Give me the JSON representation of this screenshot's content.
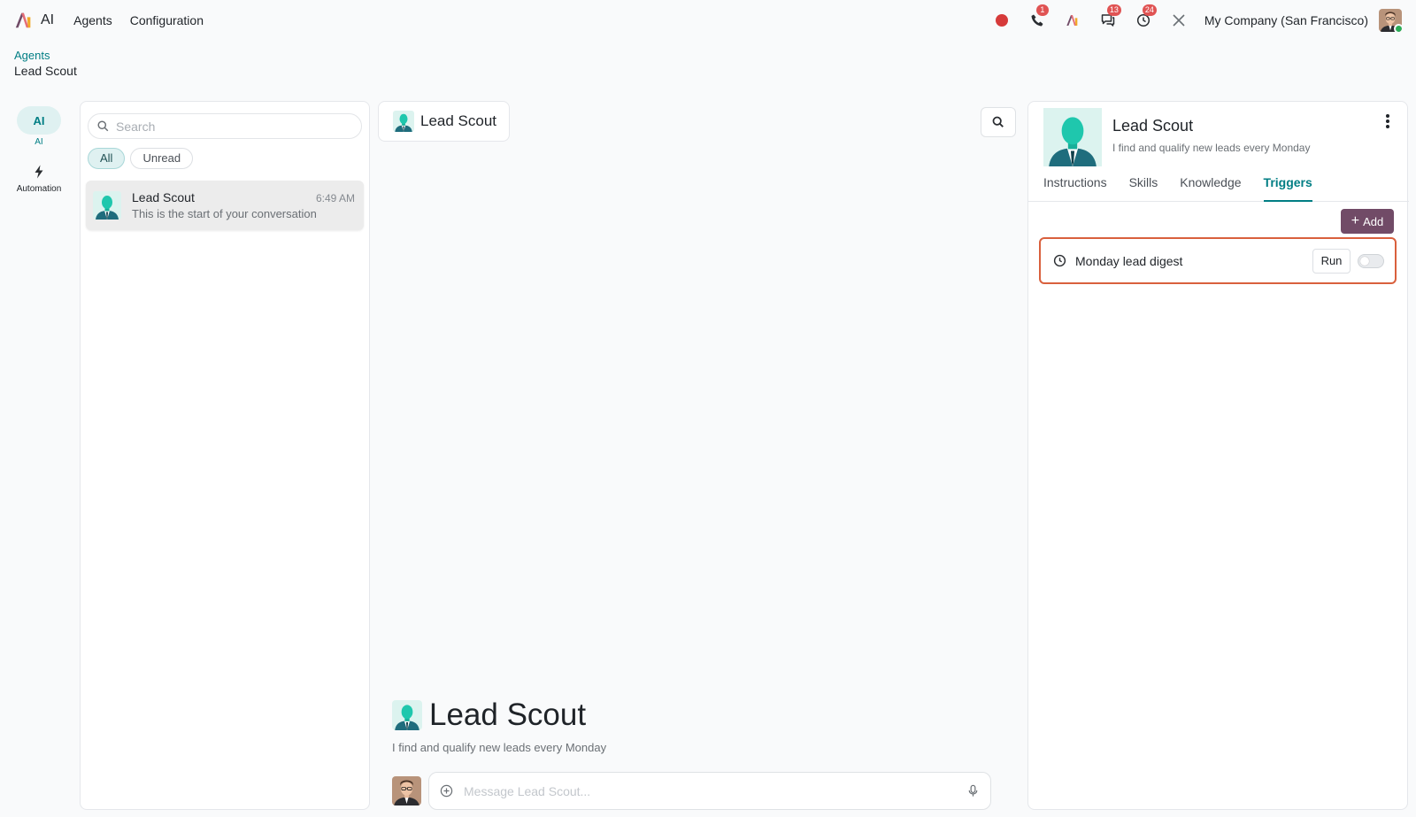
{
  "topbar": {
    "app_name": "AI",
    "nav": [
      "Agents",
      "Configuration"
    ],
    "badges": {
      "phone": "1",
      "messages": "13",
      "activities": "24"
    },
    "company": "My Company (San Francisco)"
  },
  "breadcrumb": {
    "parent": "Agents",
    "current": "Lead Scout"
  },
  "rail": {
    "ai_pill": "AI",
    "ai_label": "AI",
    "automation_label": "Automation"
  },
  "conversations": {
    "search_placeholder": "Search",
    "filters": [
      "All",
      "Unread"
    ],
    "items": [
      {
        "name": "Lead Scout",
        "time": "6:49 AM",
        "preview": "This is the start of your conversation"
      }
    ]
  },
  "chat": {
    "title": "Lead Scout",
    "intro_name": "Lead Scout",
    "intro_desc": "I find and qualify new leads every Monday",
    "composer_placeholder": "Message Lead Scout..."
  },
  "agent": {
    "name": "Lead Scout",
    "description": "I find and qualify new leads every Monday",
    "tabs": [
      "Instructions",
      "Skills",
      "Knowledge",
      "Triggers"
    ],
    "active_tab": "Triggers",
    "add_label": "Add",
    "triggers": [
      {
        "name": "Monday lead digest",
        "run_label": "Run",
        "enabled": false
      }
    ]
  },
  "colors": {
    "accent": "#017e84",
    "brand": "#714b67",
    "highlight": "#d9603d",
    "badge": "#e05353"
  }
}
